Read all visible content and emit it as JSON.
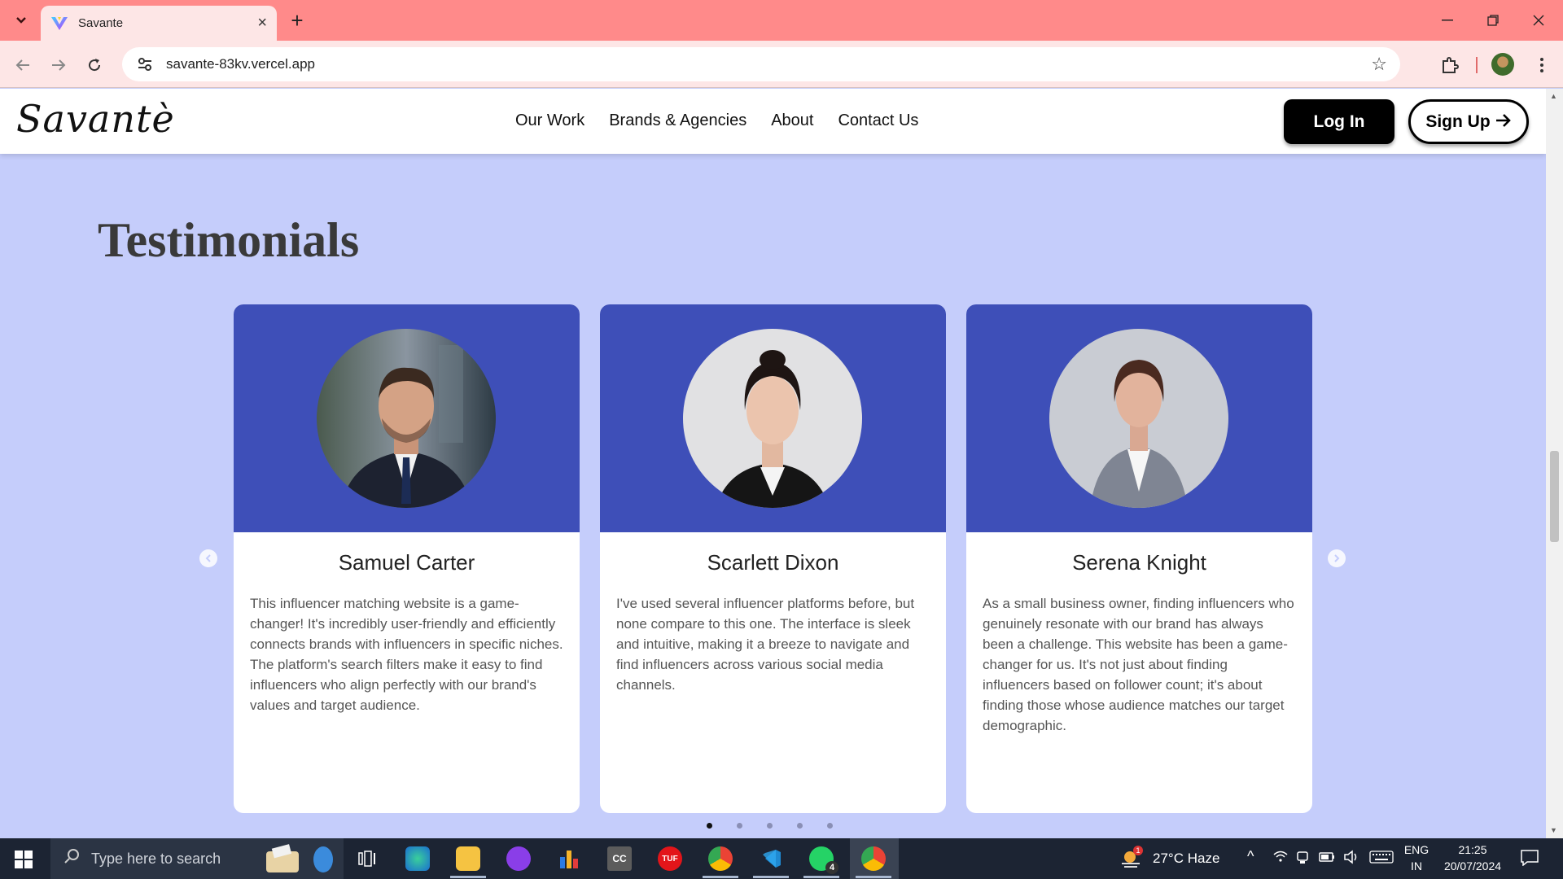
{
  "browser": {
    "tab_title": "Savante",
    "url": "savante-83kv.vercel.app"
  },
  "site": {
    "logo": "Savantè",
    "nav": [
      "Our Work",
      "Brands & Agencies",
      "About",
      "Contact Us"
    ],
    "login_label": "Log In",
    "signup_label": "Sign Up"
  },
  "testimonials": {
    "title": "Testimonials",
    "cards": [
      {
        "name": "Samuel Carter",
        "text": "This influencer matching website is a game-changer! It's incredibly user-friendly and efficiently connects brands with influencers in specific niches. The platform's search filters make it easy to find influencers who align perfectly with our brand's values and target audience."
      },
      {
        "name": "Scarlett Dixon",
        "text": "I've used several influencer platforms before, but none compare to this one. The interface is sleek and intuitive, making it a breeze to navigate and find influencers across various social media channels."
      },
      {
        "name": "Serena Knight",
        "text": "As a small business owner, finding influencers who genuinely resonate with our brand has always been a challenge. This website has been a game-changer for us. It's not just about finding influencers based on follower count; it's about finding those whose audience matches our target demographic."
      }
    ],
    "dots": 5,
    "active_dot": 0
  },
  "taskbar": {
    "search_placeholder": "Type here to search",
    "weather": "27°C  Haze",
    "weather_badge": "1",
    "lang_top": "ENG",
    "lang_bottom": "IN",
    "time": "21:25",
    "date": "20/07/2024",
    "whatsapp_badge": "4"
  }
}
